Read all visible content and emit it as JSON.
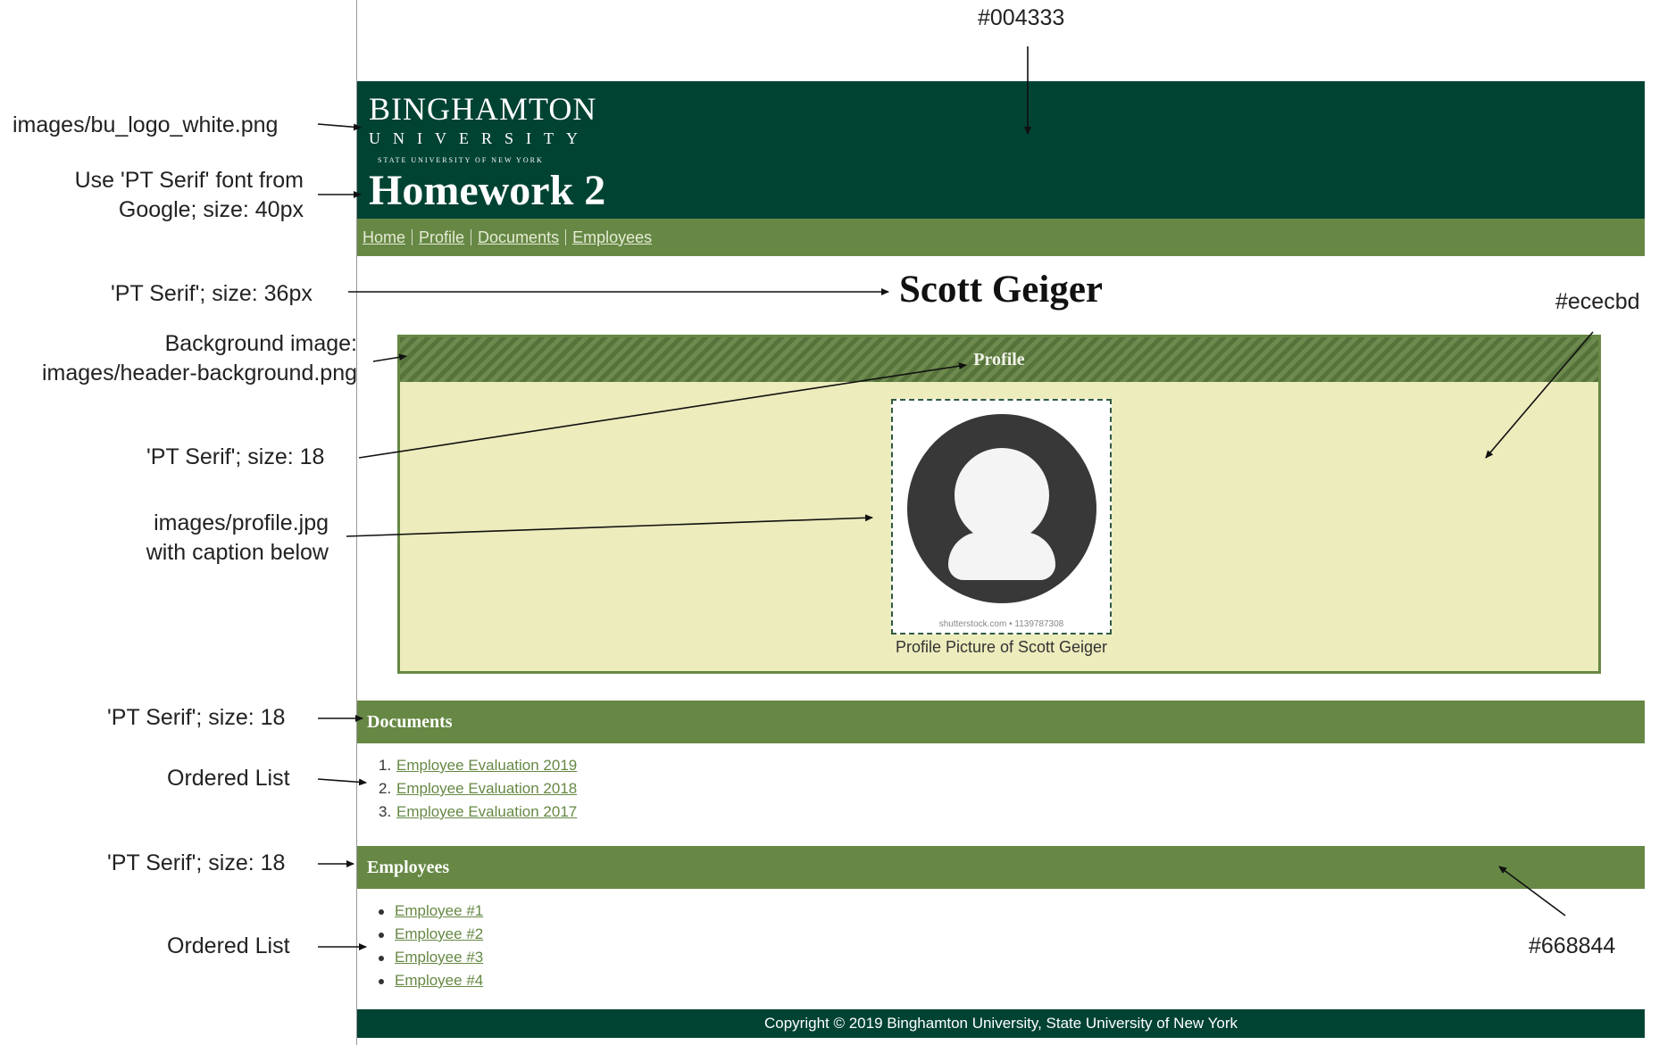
{
  "annotations": {
    "header_color": "#004333",
    "logo_image": "images/bu_logo_white.png",
    "title_font": [
      "Use 'PT Serif' font from",
      "Google; size: 40px"
    ],
    "name_font": "'PT Serif'; size: 36px",
    "background_image": [
      "Background image:",
      "images/header-background.png"
    ],
    "profile_font": "'PT Serif'; size: 18",
    "profile_image": [
      "images/profile.jpg",
      "with caption below"
    ],
    "profile_bg_color": "#ececbd",
    "documents_font": "'PT Serif'; size: 18",
    "documents_list": "Ordered List",
    "employees_font": "'PT Serif'; size: 18",
    "employees_list": "Ordered List",
    "section_color": "#668844"
  },
  "mockup": {
    "logo": {
      "line1": "BINGHAMTON",
      "line2": "UNIVERSITY",
      "line3": "STATE UNIVERSITY OF NEW YORK"
    },
    "title": "Homework 2",
    "nav": [
      "Home",
      "Profile",
      "Documents",
      "Employees"
    ],
    "name": "Scott Geiger",
    "profile": {
      "heading": "Profile",
      "watermark": "shutterstock.com • 1139787308",
      "caption": "Profile Picture of Scott Geiger"
    },
    "documents": {
      "heading": "Documents",
      "items": [
        "Employee Evaluation 2019",
        "Employee Evaluation 2018",
        "Employee Evaluation 2017"
      ]
    },
    "employees": {
      "heading": "Employees",
      "items": [
        "Employee #1",
        "Employee #2",
        "Employee #3",
        "Employee #4"
      ]
    },
    "footer": "Copyright © 2019 Binghamton University, State University of New York"
  },
  "colors": {
    "header": "#004333",
    "section": "#668844",
    "profile_bg": "#ececbd"
  }
}
